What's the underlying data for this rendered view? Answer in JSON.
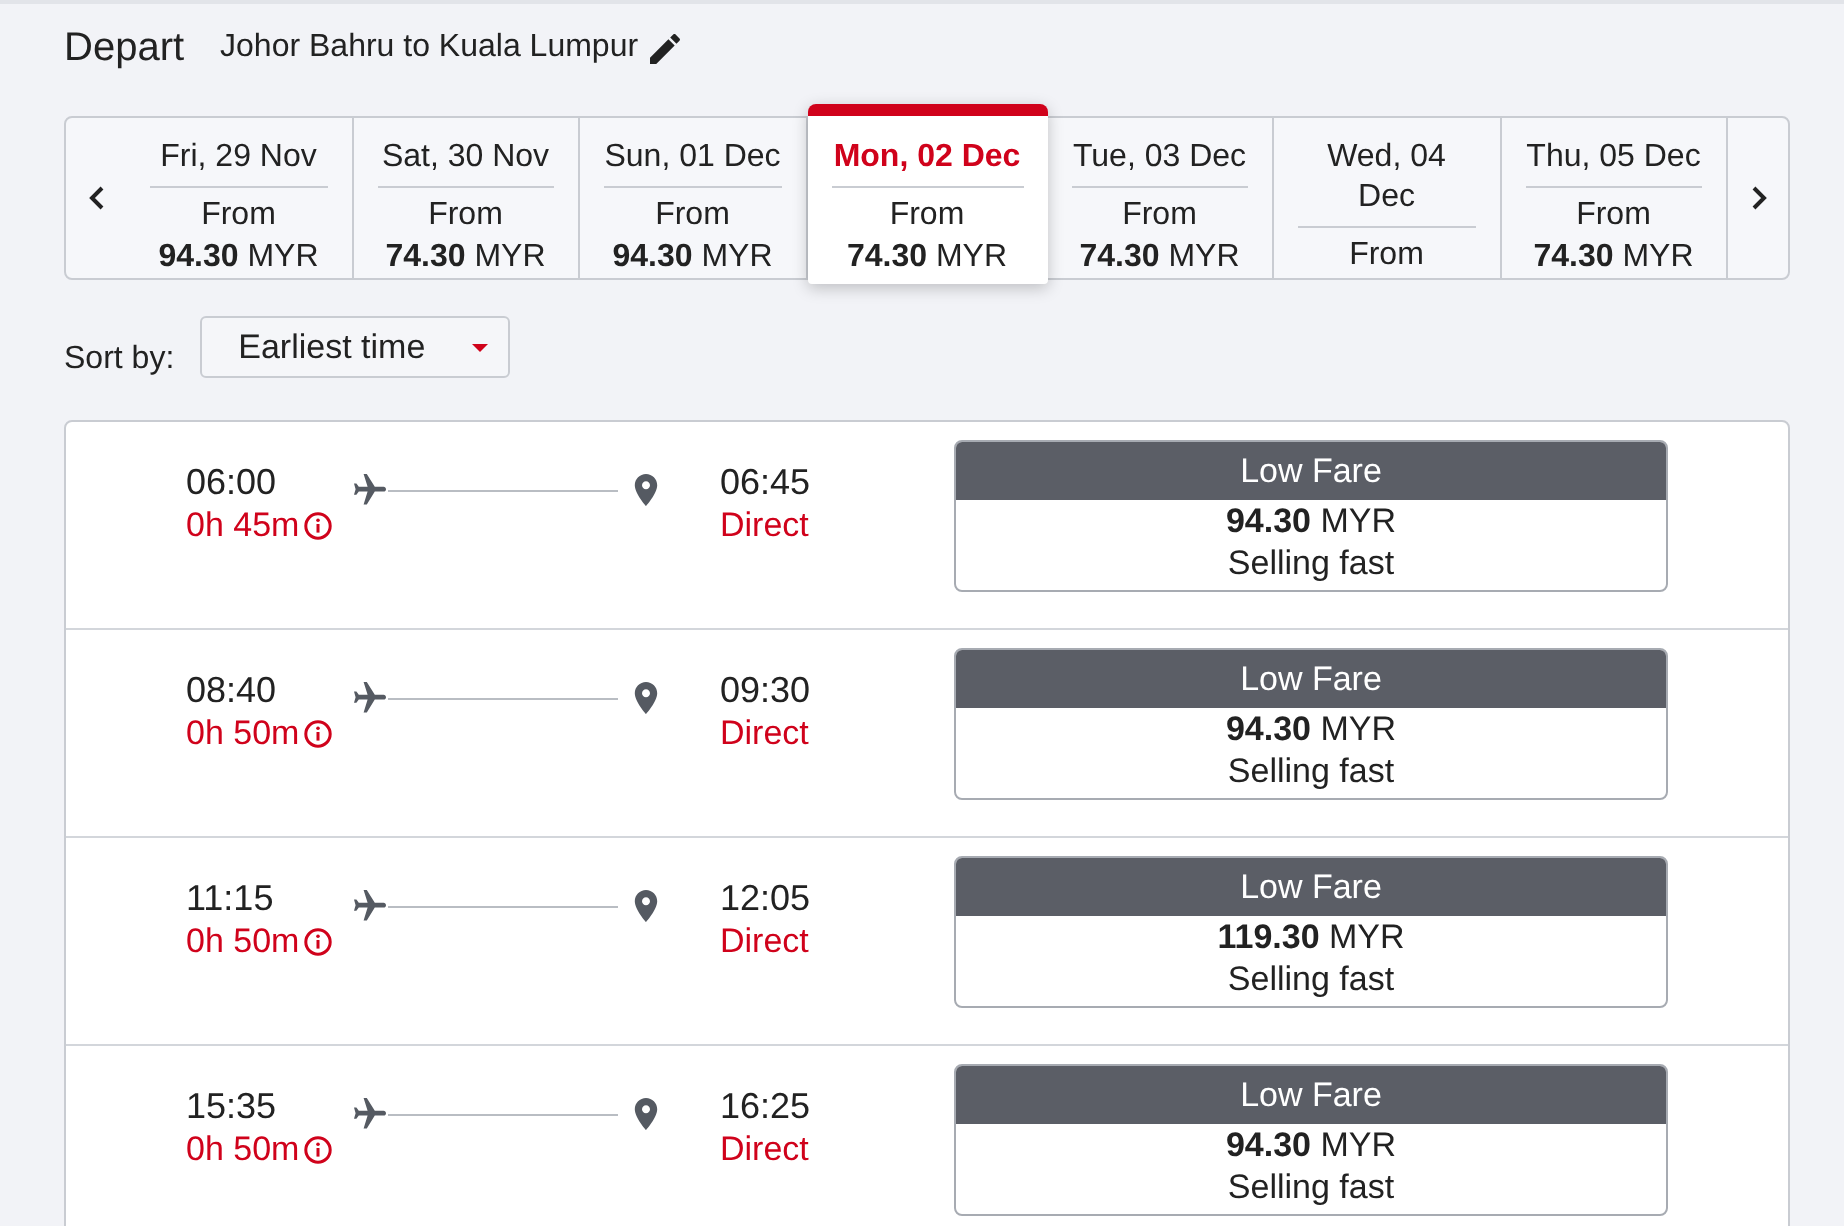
{
  "header": {
    "title": "Depart",
    "route": "Johor Bahru to Kuala Lumpur"
  },
  "date_strip": {
    "dates": [
      {
        "date": "Fri, 29 Nov",
        "from": "From",
        "price": "**94.30** MYR",
        "selected": false
      },
      {
        "date": "Sat, 30 Nov",
        "from": "From",
        "price": "**74.30** MYR",
        "selected": false
      },
      {
        "date": "Sun, 01 Dec",
        "from": "From",
        "price": "**94.30** MYR",
        "selected": false
      },
      {
        "date": "Mon, 02 Dec",
        "from": "From",
        "price": "**74.30** MYR",
        "selected": true
      },
      {
        "date": "Tue, 03 Dec",
        "from": "From",
        "price": "**74.30** MYR",
        "selected": false
      },
      {
        "date": "Wed, 04 Dec",
        "from": "From",
        "selected": false
      },
      {
        "date": "Thu, 05 Dec",
        "from": "From",
        "price": "**74.30** MYR",
        "selected": false
      }
    ]
  },
  "sort": {
    "label": "Sort by:",
    "value": "Earliest time"
  },
  "flights": [
    {
      "depart": "06:00",
      "duration": "0h 45m",
      "arrive": "06:45",
      "stops": "Direct",
      "fare": {
        "label": "Low Fare",
        "price": "**94.30** MYR",
        "note": "Selling fast"
      }
    },
    {
      "depart": "08:40",
      "duration": "0h 50m",
      "arrive": "09:30",
      "stops": "Direct",
      "fare": {
        "label": "Low Fare",
        "price": "**94.30** MYR",
        "note": "Selling fast"
      }
    },
    {
      "depart": "11:15",
      "duration": "0h 50m",
      "arrive": "12:05",
      "stops": "Direct",
      "fare": {
        "label": "Low Fare",
        "price": "**119.30** MYR",
        "note": "Selling fast"
      }
    },
    {
      "depart": "15:35",
      "duration": "0h 50m",
      "arrive": "16:25",
      "stops": "Direct",
      "fare": {
        "label": "Low Fare",
        "price": "**94.30** MYR",
        "note": "Selling fast"
      }
    }
  ]
}
